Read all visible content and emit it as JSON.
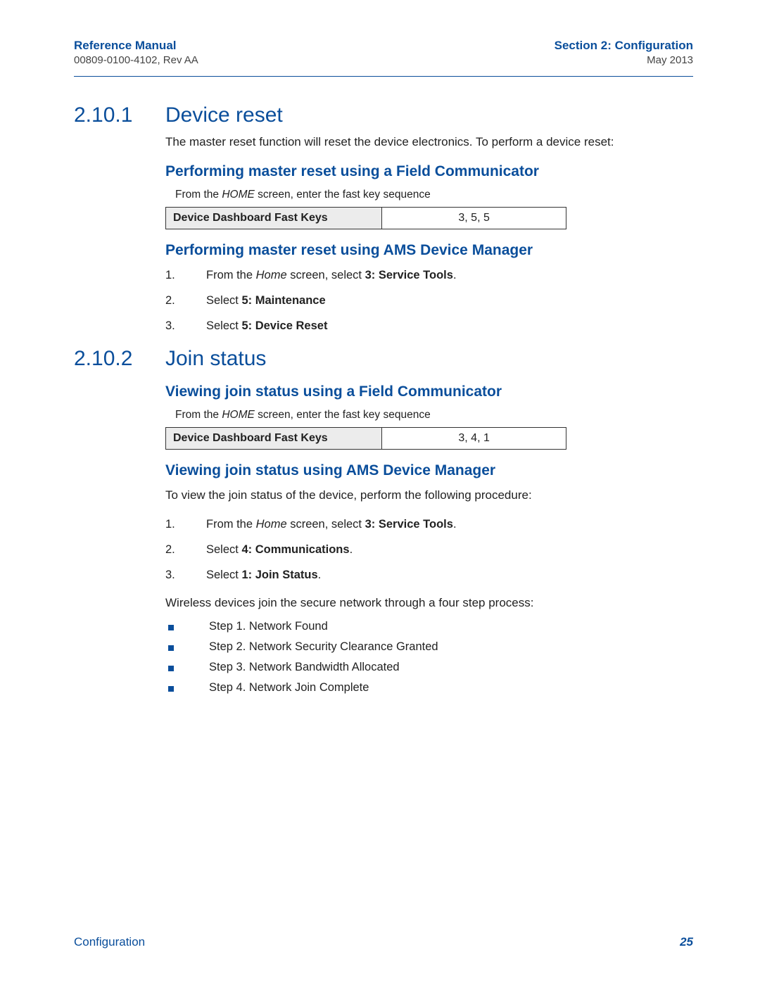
{
  "header": {
    "left_title": "Reference Manual",
    "left_sub": "00809-0100-4102, Rev AA",
    "right_title": "Section 2: Configuration",
    "right_sub": "May 2013"
  },
  "s1": {
    "num": "2.10.1",
    "title": "Device reset",
    "intro": "The master reset function will reset the device electronics. To perform a device reset:",
    "sub1": "Performing master reset using a Field Communicator",
    "instr1_pre": "From the ",
    "instr1_home": "HOME",
    "instr1_post": " screen, enter the fast key sequence",
    "fk_label": "Device Dashboard Fast Keys",
    "fk_val": "3, 5, 5",
    "sub2": "Performing master reset using AMS Device Manager",
    "step1_pre": "From the ",
    "step1_home": "Home",
    "step1_mid": " screen, select ",
    "step1_bold": "3: Service Tools",
    "step1_post": ".",
    "step2_pre": "Select ",
    "step2_bold": "5: Maintenance",
    "step3_pre": "Select ",
    "step3_bold": "5: Device Reset"
  },
  "s2": {
    "num": "2.10.2",
    "title": "Join status",
    "sub1": "Viewing join status using a Field Communicator",
    "instr1_pre": "From the ",
    "instr1_home": "HOME",
    "instr1_post": " screen, enter the fast key sequence",
    "fk_label": "Device Dashboard Fast Keys",
    "fk_val": "3, 4, 1",
    "sub2": "Viewing join status using AMS Device Manager",
    "intro2": "To view the join status of the device, perform the following procedure:",
    "step1_pre": "From the ",
    "step1_home": "Home",
    "step1_mid": " screen, select ",
    "step1_bold": "3: Service Tools",
    "step1_post": ".",
    "step2_pre": "Select ",
    "step2_bold": "4: Communications",
    "step2_post": ".",
    "step3_pre": "Select ",
    "step3_bold": "1: Join Status",
    "step3_post": ".",
    "process_intro": "Wireless devices join the secure network through a four step process:",
    "bullets": [
      "Step 1. Network Found",
      "Step 2. Network Security Clearance Granted",
      "Step 3. Network Bandwidth Allocated",
      "Step 4. Network Join Complete"
    ]
  },
  "footer": {
    "left": "Configuration",
    "page": "25"
  },
  "nums": {
    "n1": "1.",
    "n2": "2.",
    "n3": "3."
  }
}
